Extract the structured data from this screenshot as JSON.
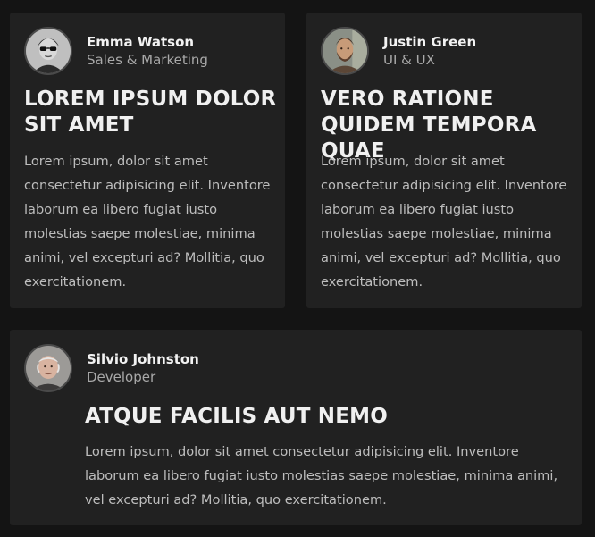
{
  "cards": [
    {
      "author_name": "Emma Watson",
      "author_role": "Sales & Marketing",
      "avatar": "avatar-emma-icon",
      "title": "LOREM IPSUM DOLOR SIT AMET",
      "body": "Lorem ipsum, dolor sit amet consectetur adipisicing elit. Inventore laborum ea libero fugiat iusto molestias saepe molestiae, minima animi, vel excepturi ad? Mollitia, quo exercitationem."
    },
    {
      "author_name": "Justin Green",
      "author_role": "UI & UX",
      "avatar": "avatar-justin-icon",
      "title": "VERO RATIONE QUIDEM TEMPORA QUAE",
      "body": "Lorem ipsum, dolor sit amet consectetur adipisicing elit. Inventore laborum ea libero fugiat iusto molestias saepe molestiae, minima animi, vel excepturi ad? Mollitia, quo exercitationem."
    },
    {
      "author_name": "Silvio Johnston",
      "author_role": "Developer",
      "avatar": "avatar-silvio-icon",
      "title": "ATQUE FACILIS AUT NEMO",
      "body": "Lorem ipsum, dolor sit amet consectetur adipisicing elit. Inventore laborum ea libero fugiat iusto molestias saepe molestiae, minima animi, vel excepturi ad? Mollitia, quo exercitationem."
    }
  ],
  "colors": {
    "page_background": "#141414",
    "card_background": "#212121",
    "title": "#f0f0f0",
    "body_text": "#bdbdbd",
    "role_text": "#a9a9a9"
  }
}
